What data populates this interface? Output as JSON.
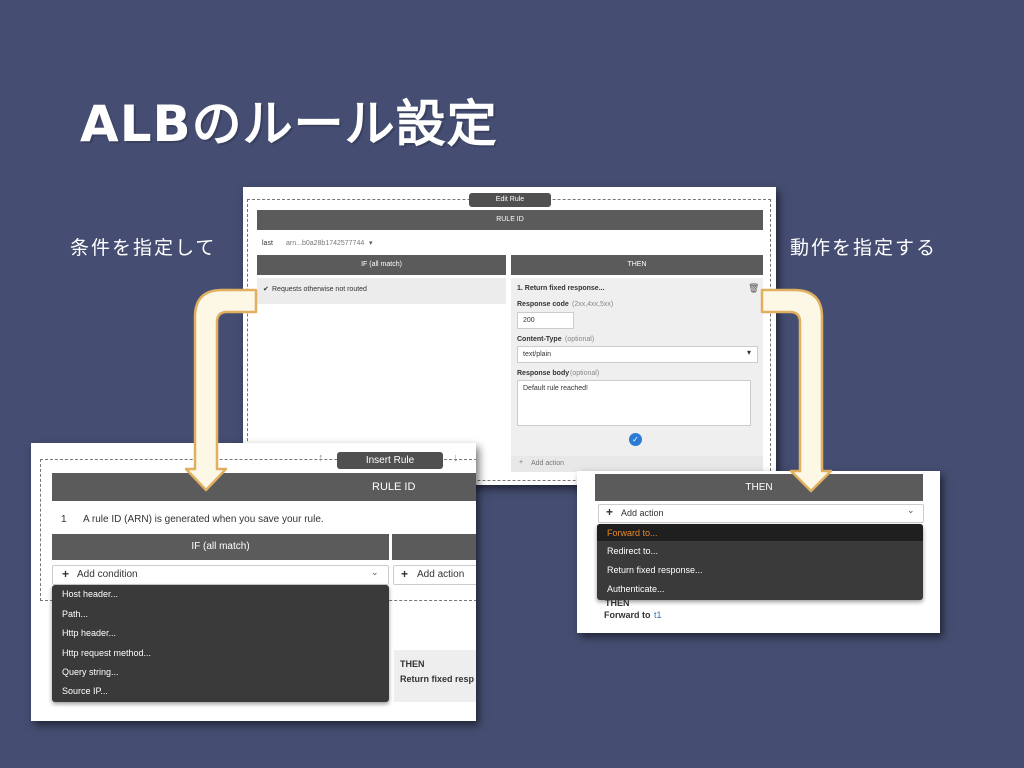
{
  "slide": {
    "title": "ALBのルール設定",
    "left_label": "条件を指定して",
    "right_label": "動作を指定する"
  },
  "edit_rule": {
    "header_button": "Edit Rule",
    "rule_id_bar": "RULE ID",
    "last_label": "last",
    "arn_value": "arn...b0a28b1742577744",
    "if_header": "IF (all match)",
    "then_header": "THEN",
    "condition_text": "Requests otherwise not routed",
    "action_title": "1. Return fixed response...",
    "response_code_label": "Response code",
    "response_code_hint": "(2xx,4xx,5xx)",
    "response_code_value": "200",
    "content_type_label": "Content-Type",
    "content_type_hint": "(optional)",
    "content_type_value": "text/plain",
    "response_body_label": "Response body",
    "response_body_hint": "(optional)",
    "response_body_value": "Default rule reached!",
    "add_action_label": "Add action"
  },
  "insert_rule": {
    "header_button": "Insert Rule",
    "rule_id_bar": "RULE ID",
    "row_number": "1",
    "row_text": "A rule ID (ARN) is generated when you save your rule.",
    "if_header": "IF (all match)",
    "add_condition_label": "Add condition",
    "add_action_label": "Add action",
    "condition_options": [
      "Host header...",
      "Path...",
      "Http header...",
      "Http request method...",
      "Query string...",
      "Source IP..."
    ],
    "then_label": "THEN",
    "then_value": "Return fixed resp"
  },
  "then_panel": {
    "then_header": "THEN",
    "add_action_label": "Add action",
    "action_options": [
      "Forward to...",
      "Redirect to...",
      "Return fixed response...",
      "Authenticate..."
    ],
    "highlight_color": "#e8892b",
    "then_label": "THEN",
    "forward_label": "Forward to",
    "forward_target": "t1"
  }
}
